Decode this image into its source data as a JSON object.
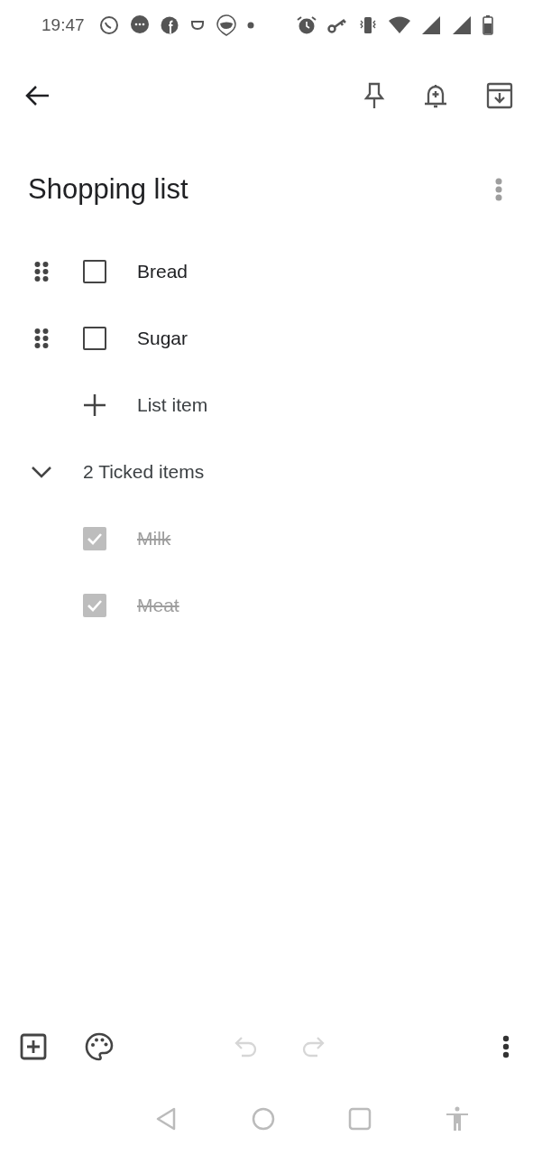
{
  "status_bar": {
    "time": "19:47"
  },
  "note": {
    "title": "Shopping list"
  },
  "items": [
    {
      "text": "Bread",
      "checked": false
    },
    {
      "text": "Sugar",
      "checked": false
    }
  ],
  "add_item": {
    "placeholder": "List item"
  },
  "ticked": {
    "label": "2 Ticked items",
    "expanded": true,
    "items": [
      {
        "text": "Milk",
        "checked": true
      },
      {
        "text": "Meat",
        "checked": true
      }
    ]
  },
  "bottom_bar": {
    "undo_disabled": true,
    "redo_disabled": true
  }
}
